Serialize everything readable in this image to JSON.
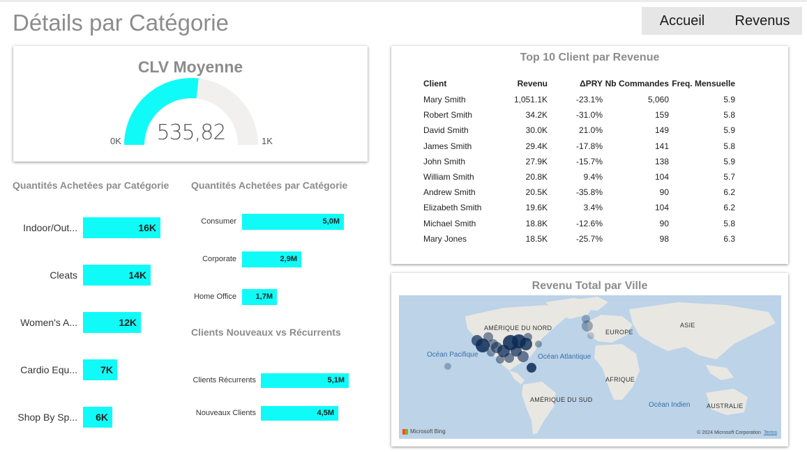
{
  "header": {
    "title": "Détails par Catégorie",
    "nav": {
      "accueil": "Accueil",
      "revenus": "Revenus"
    }
  },
  "clv": {
    "title": "CLV Moyenne",
    "value": "535,82",
    "min": "0K",
    "max": "1K",
    "fraction": 0.5358,
    "colors": {
      "fill": "#10fbf7",
      "track": "#f1f0ef"
    }
  },
  "categories": {
    "title": "Quantités Achetées par Catégorie",
    "items": [
      {
        "label": "Indoor/Out...",
        "value": "16K",
        "amount": 16
      },
      {
        "label": "Cleats",
        "value": "14K",
        "amount": 14
      },
      {
        "label": "Women's A...",
        "value": "12K",
        "amount": 12
      },
      {
        "label": "Cardio Equ...",
        "value": "7K",
        "amount": 7
      },
      {
        "label": "Shop By Sp...",
        "value": "6K",
        "amount": 6
      }
    ]
  },
  "segments": {
    "title": "Quantités Achetées par Catégorie",
    "items": [
      {
        "label": "Consumer",
        "value": "5,0M",
        "amount": 5.0
      },
      {
        "label": "Corporate",
        "value": "2,9M",
        "amount": 2.9
      },
      {
        "label": "Home Office",
        "value": "1,7M",
        "amount": 1.7
      }
    ]
  },
  "clients": {
    "title": "Clients Nouveaux vs Récurrents",
    "items": [
      {
        "label": "Clients Récurrents",
        "value": "5,1M",
        "amount": 5.1
      },
      {
        "label": "Nouveaux Clients",
        "value": "4,5M",
        "amount": 4.5
      }
    ]
  },
  "top10": {
    "title": "Top 10 Client par Revenue",
    "columns": [
      "Client",
      "Revenu",
      "ΔPRY",
      "Nb Commandes",
      "Freq. Mensuelle"
    ],
    "rows": [
      [
        "Mary Smith",
        "1,051.1K",
        "-23.1%",
        "5,060",
        "5.9"
      ],
      [
        "Robert Smith",
        "34.2K",
        "-31.0%",
        "159",
        "5.8"
      ],
      [
        "David Smith",
        "30.0K",
        "21.0%",
        "149",
        "5.9"
      ],
      [
        "James Smith",
        "29.4K",
        "-17.8%",
        "141",
        "5.8"
      ],
      [
        "John Smith",
        "27.9K",
        "-15.7%",
        "138",
        "5.9"
      ],
      [
        "William Smith",
        "20.8K",
        "9.4%",
        "104",
        "5.7"
      ],
      [
        "Andrew Smith",
        "20.5K",
        "-35.8%",
        "90",
        "6.2"
      ],
      [
        "Elizabeth Smith",
        "19.6K",
        "3.4%",
        "104",
        "6.2"
      ],
      [
        "Michael Smith",
        "18.8K",
        "-12.6%",
        "90",
        "5.8"
      ],
      [
        "Mary Jones",
        "18.5K",
        "-25.7%",
        "98",
        "6.3"
      ]
    ]
  },
  "map": {
    "title": "Revenu Total par Ville",
    "labels": {
      "north_america": "AMÉRIQUE DU NORD",
      "europe": "EUROPE",
      "asia": "ASIE",
      "africa": "AFRIQUE",
      "south_america": "AMÉRIQUE DU SUD",
      "australia": "AUSTRALIE",
      "pacific": "Océan Pacifique",
      "atlantic": "Océan Atlantique",
      "indian": "Océan Indien"
    },
    "copyright": "© 2024 Microsoft Corporation",
    "terms": "Terms",
    "brand": "Microsoft Bing"
  }
}
